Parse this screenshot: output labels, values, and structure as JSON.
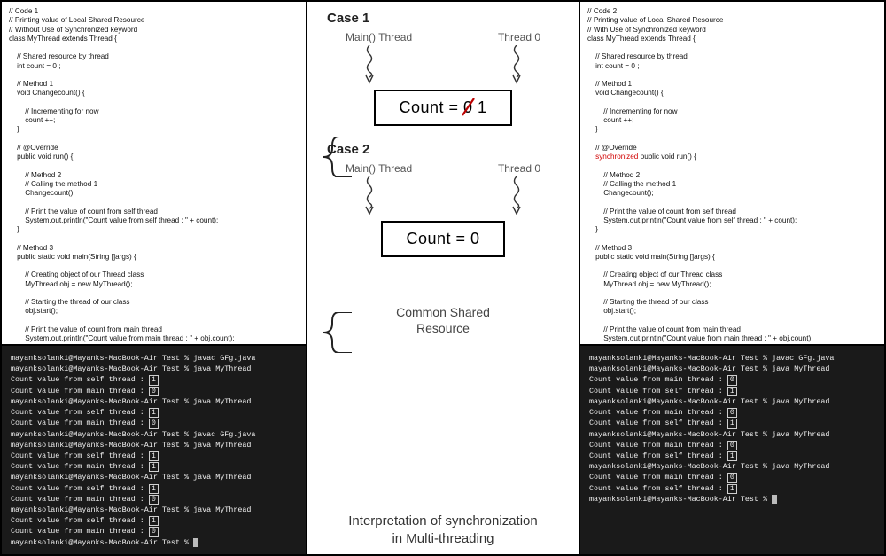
{
  "code1": {
    "header": "// Code 1\n// Printing value of Local Shared Resource\n// Without Use of Synchronized keyword\nclass MyThread extends Thread {\n\n    // Shared resource by thread\n    int count = 0 ;\n\n    // Method 1\n    void Changecount() {\n\n        // Incrementing for now\n        count ++;\n    }\n\n    // @Override\n    public void run() {\n\n        // Method 2\n        // Calling the method 1\n        Changecount();\n\n        // Print the value of count from self thread\n        System.out.println(\"Count value from self thread : \" + count);\n    }\n\n    // Method 3\n    public static void main(String []args) {\n\n        // Creating object of our Thread class\n        MyThread obj = new MyThread();\n\n        // Starting the thread of our class\n        obj.start();\n\n        // Print the value of count from main thread\n        System.out.println(\"Count value from main thread : \" + obj.count);\n    }\n}"
  },
  "code2": {
    "pre": "// Code 2\n// Printing value of Local Shared Resource\n// With Use of Synchronized keyword\nclass MyThread extends Thread {\n\n    // Shared resource by thread\n    int count = 0 ;\n\n    // Method 1\n    void Changecount() {\n\n        // Incrementing for now\n        count ++;\n    }\n\n    // @Override\n    ",
    "sync": "synchronized",
    "post": " public void run() {\n\n        // Method 2\n        // Calling the method 1\n        Changecount();\n\n        // Print the value of count from self thread\n        System.out.println(\"Count value from self thread : \" + count);\n    }\n\n    // Method 3\n    public static void main(String []args) {\n\n        // Creating object of our Thread class\n        MyThread obj = new MyThread();\n\n        // Starting the thread of our class\n        obj.start();\n\n        // Print the value of count from main thread\n        System.out.println(\"Count value from main thread : \" + obj.count);\n    }\n}"
  },
  "term": {
    "prompt": "mayanksolanki@Mayanks-MacBook-Air Test % ",
    "compile": "javac GFg.java",
    "run": "java MyThread",
    "self_line": "Count value from self thread : ",
    "main_line": "Count value from main thread : ",
    "one": "1",
    "zero": "0"
  },
  "mid": {
    "case1": "Case 1",
    "case2": "Case 2",
    "main_thread": "Main() Thread",
    "thread0": "Thread 0",
    "count_eq": "Count = ",
    "zero": "0",
    "one": " 1",
    "zero_only": "Count = 0",
    "csr": "Common Shared\nResource",
    "interp": "Interpretation of synchronization\nin Multi-threading"
  }
}
